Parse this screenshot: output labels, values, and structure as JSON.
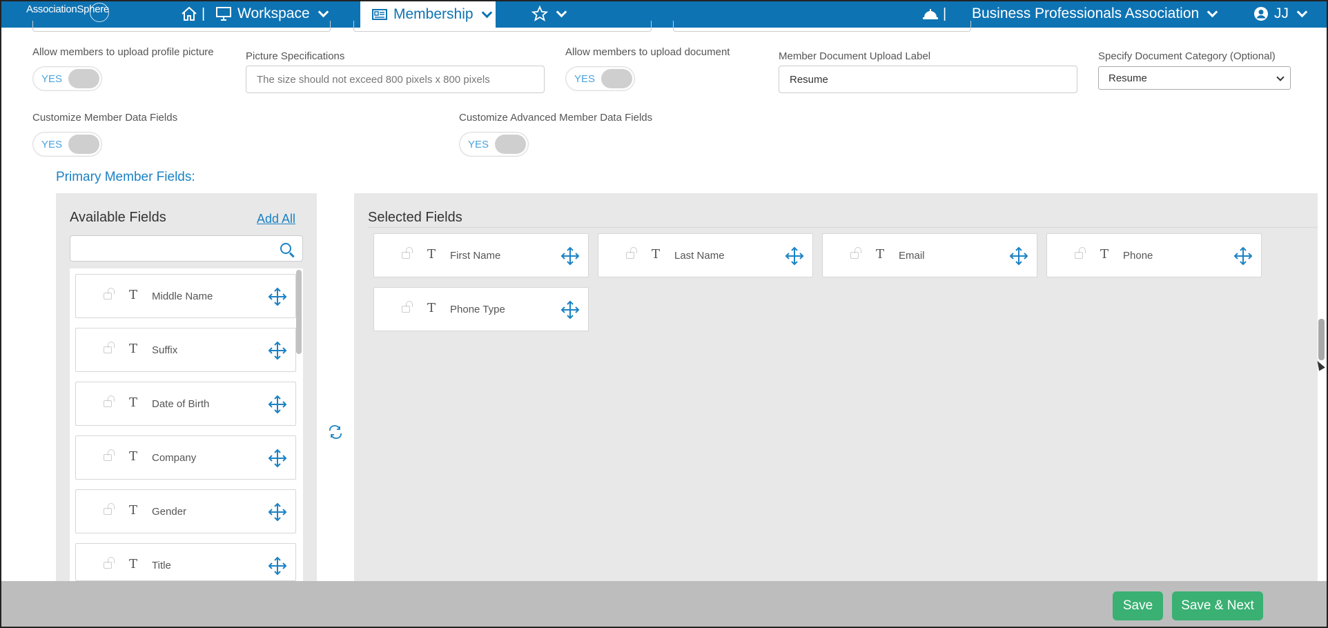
{
  "nav": {
    "logo": "AssociationSphere",
    "separator": "|",
    "workspace": "Workspace",
    "membership": "Membership",
    "association": "Business Professionals Association",
    "user": "JJ"
  },
  "settings": {
    "upload_picture_label": "Allow members to upload profile picture",
    "upload_picture_toggle": "YES",
    "picture_spec_label": "Picture Specifications",
    "picture_spec_placeholder": "The size should not exceed 800 pixels x 800 pixels",
    "upload_document_label": "Allow members to upload document",
    "upload_document_toggle": "YES",
    "document_label_label": "Member Document Upload Label",
    "document_label_value": "Resume",
    "document_category_label": "Specify Document Category (Optional)",
    "document_category_value": "Resume",
    "customize_fields_label": "Customize Member Data Fields",
    "customize_fields_toggle": "YES",
    "customize_advanced_label": "Customize Advanced Member Data Fields",
    "customize_advanced_toggle": "YES"
  },
  "primary": {
    "title": "Primary Member Fields:",
    "available_title": "Available Fields",
    "add_all": "Add All",
    "selected_title": "Selected Fields",
    "field_type_glyph": "T",
    "available": [
      "Middle Name",
      "Suffix",
      "Date of Birth",
      "Company",
      "Gender",
      "Title"
    ],
    "selected": [
      "First Name",
      "Last Name",
      "Email",
      "Phone",
      "Phone Type"
    ]
  },
  "footer": {
    "save": "Save",
    "save_next": "Save & Next"
  },
  "colors": {
    "nav_bg": "#0e73b3",
    "accent": "#1a82c4",
    "button": "#3ab073",
    "footer": "#bdbdbd"
  }
}
